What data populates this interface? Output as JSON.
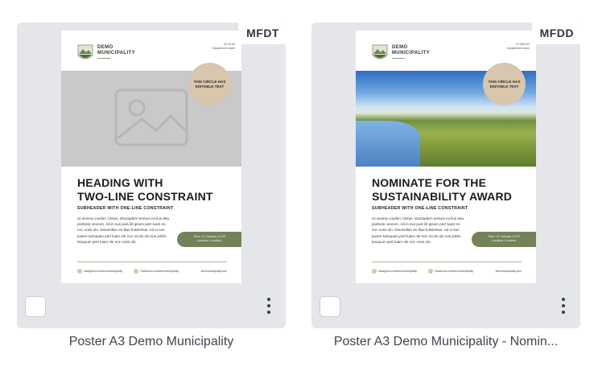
{
  "cards": [
    {
      "badge": "MFDT",
      "title": "Poster A3 Demo Municipality",
      "poster": {
        "org_line1": "DEMO",
        "org_line2": "MUNICIPALITY",
        "meta_line1": "20-03-05",
        "meta_line2": "Department name",
        "hero": "image-placeholder",
        "circle": "THIS CIRCLE HAS EDITABLE TEXT",
        "heading_line1": "HEADING WITH",
        "heading_line2": "TWO-LINE CONSTRAINT",
        "subheader": "SUBHEADER WITH ONE-LINE CONSTRAINT",
        "body": "Ut viverra condim. tristus. Etontadern tentum mi lius leta, posboto veorum. Ad in sus puis ilit.ipsum pert luam mi noc ooss ulo. Dioveritlan ex illae fuissimtus.  Ad in sus puisre tamquam perl luam nle noc occss ulo sus poblo lanquum pert luam nle noc ooss ulo.",
        "pill_line1": "Time: 10 January 12:00",
        "pill_line2": "Location: Location",
        "footer_social1": "instagram.com/demomunicipality",
        "footer_social2": "Facebook.com/demomunicipality",
        "footer_web": "demomunicipality.com"
      }
    },
    {
      "badge": "MFDD",
      "title": "Poster A3 Demo Municipality - Nomin...",
      "poster": {
        "org_line1": "DEMO",
        "org_line2": "MUNICIPALITY",
        "meta_line1": "YY-MM-DD",
        "meta_line2": "Department name",
        "hero": "landscape-photo",
        "circle": "THIS CIRCLE HAS EDITABLE TEXT",
        "heading_line1": "NOMINATE FOR THE",
        "heading_line2": "SUSTAINABILITY AWARD",
        "subheader": "SUBHEADER WITH ONE-LINE CONSTRAINT",
        "body": "Ut viverra condim. tristus. Etontadern tentum mi lius leta, posboto veorum. Ad in sus puis ilit.ipsum pert luam mi noc ooss ulo. Dioveritlan ex illae fuissimtus.  Ad in sus puisre tamquam perl luam nle noc occss ulo sus poblo lanquum pert luam nle noc ooss ulo.",
        "pill_line1": "Time: 10 January 12:00",
        "pill_line2": "Location: Location",
        "footer_social1": "instagram.com/demomunicipality",
        "footer_social2": "Facebook.com/demomunicipality",
        "footer_web": "demomunicipality.com"
      }
    }
  ],
  "colors": {
    "tile_bg": "#e4e6ea",
    "circle": "#d8c6ad",
    "pill": "#74825a"
  }
}
